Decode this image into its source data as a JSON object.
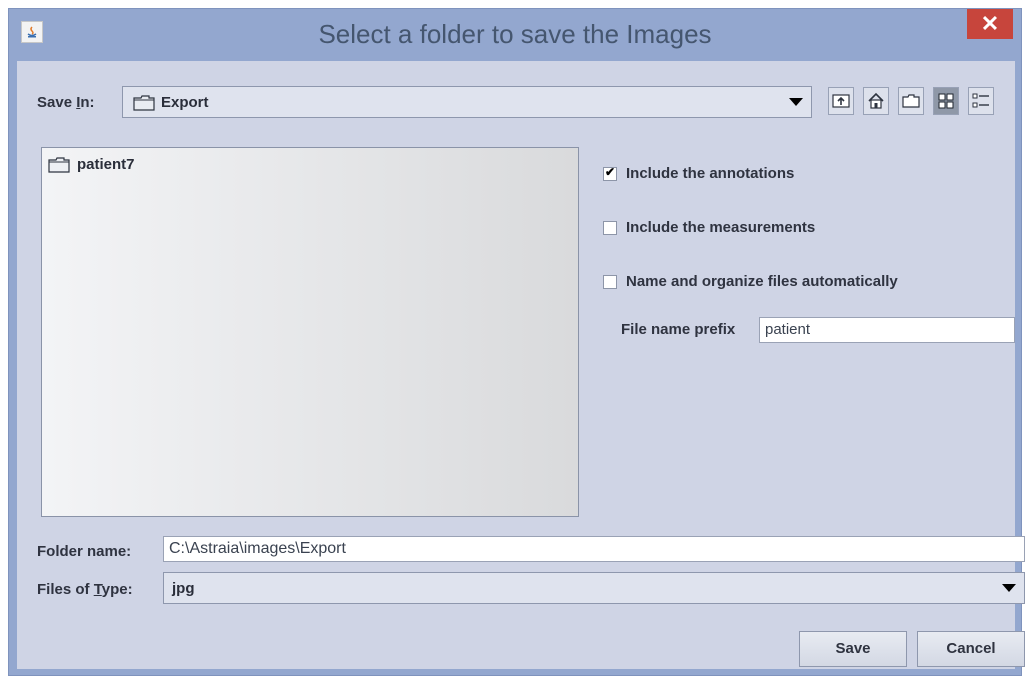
{
  "window": {
    "title": "Select a folder to save the Images",
    "close_label": "✕"
  },
  "save_in": {
    "label_pre": "Save ",
    "label_mnemonic": "I",
    "label_post": "n:",
    "value": "Export"
  },
  "toolbar": {
    "icons": [
      "up-one-level-icon",
      "home-icon",
      "new-folder-icon",
      "list-view-icon",
      "details-view-icon"
    ],
    "active_icon": "list-view-icon"
  },
  "files": [
    {
      "name": "patient7",
      "type": "folder"
    }
  ],
  "options": {
    "include_annotations": {
      "label": "Include the annotations",
      "checked": true
    },
    "include_measurements": {
      "label": "Include the measurements",
      "checked": false
    },
    "auto_organize": {
      "label": "Name and organize files automatically",
      "checked": false
    },
    "prefix_label": "File name prefix",
    "prefix_value": "patient"
  },
  "folder_name": {
    "label": "Folder name:",
    "value": "C:\\Astraia\\images\\Export"
  },
  "files_of_type": {
    "label_pre": "Files of ",
    "label_mnemonic": "T",
    "label_post": "ype:",
    "value": "jpg"
  },
  "buttons": {
    "save": "Save",
    "cancel": "Cancel"
  },
  "colors": {
    "frame": "#93a7cf",
    "client": "#cfd4e5",
    "close": "#c7453c"
  }
}
